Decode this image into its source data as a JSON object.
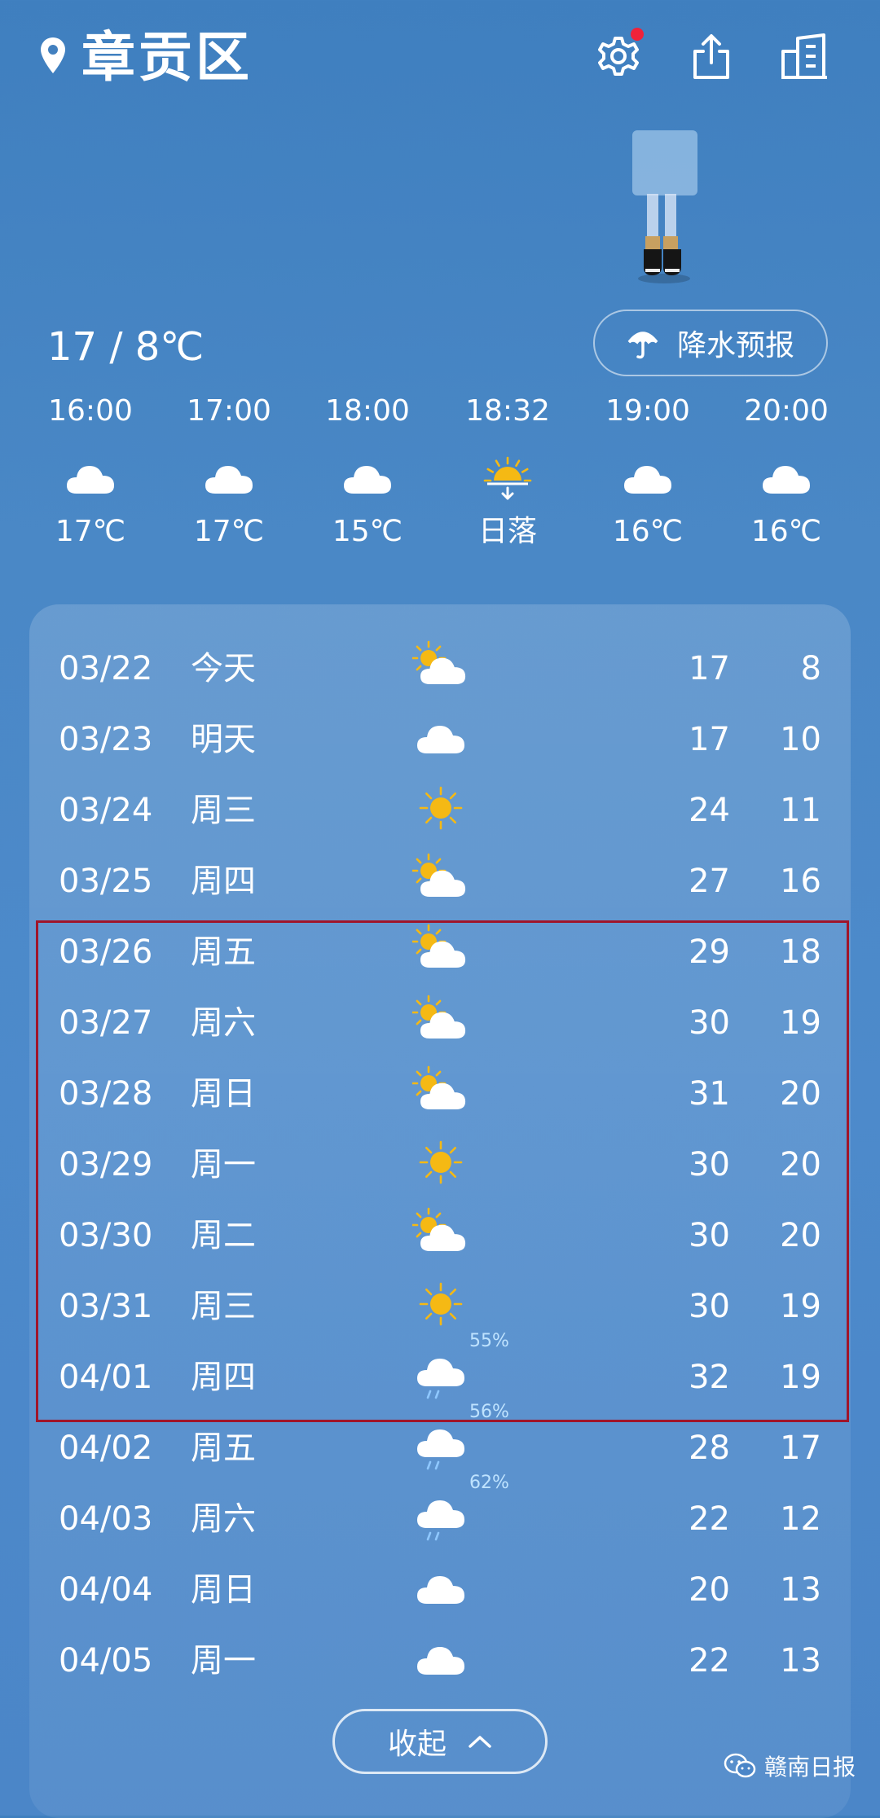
{
  "header": {
    "location": "章贡区",
    "has_notification_dot": true
  },
  "summary": {
    "temp_range": "17 / 8℃",
    "precip_button": "降水预报"
  },
  "hourly": [
    {
      "time": "16:00",
      "icon": "cloud-icon",
      "value": "17℃"
    },
    {
      "time": "17:00",
      "icon": "cloud-icon",
      "value": "17℃"
    },
    {
      "time": "18:00",
      "icon": "cloud-icon",
      "value": "15℃"
    },
    {
      "time": "18:32",
      "icon": "sunset-icon",
      "value": "日落"
    },
    {
      "time": "19:00",
      "icon": "cloud-icon",
      "value": "16℃"
    },
    {
      "time": "20:00",
      "icon": "cloud-icon",
      "value": "16℃"
    }
  ],
  "daily": [
    {
      "date": "03/22",
      "weekday": "今天",
      "icon": "partly-cloudy-icon",
      "precip": "",
      "high": "17",
      "low": "8"
    },
    {
      "date": "03/23",
      "weekday": "明天",
      "icon": "cloud-icon",
      "precip": "",
      "high": "17",
      "low": "10"
    },
    {
      "date": "03/24",
      "weekday": "周三",
      "icon": "sun-icon",
      "precip": "",
      "high": "24",
      "low": "11"
    },
    {
      "date": "03/25",
      "weekday": "周四",
      "icon": "partly-cloudy-icon",
      "precip": "",
      "high": "27",
      "low": "16"
    },
    {
      "date": "03/26",
      "weekday": "周五",
      "icon": "partly-cloudy-icon",
      "precip": "",
      "high": "29",
      "low": "18"
    },
    {
      "date": "03/27",
      "weekday": "周六",
      "icon": "partly-cloudy-icon",
      "precip": "",
      "high": "30",
      "low": "19"
    },
    {
      "date": "03/28",
      "weekday": "周日",
      "icon": "partly-cloudy-icon",
      "precip": "",
      "high": "31",
      "low": "20"
    },
    {
      "date": "03/29",
      "weekday": "周一",
      "icon": "sun-icon",
      "precip": "",
      "high": "30",
      "low": "20"
    },
    {
      "date": "03/30",
      "weekday": "周二",
      "icon": "partly-cloudy-icon",
      "precip": "",
      "high": "30",
      "low": "20"
    },
    {
      "date": "03/31",
      "weekday": "周三",
      "icon": "sun-icon",
      "precip": "",
      "high": "30",
      "low": "19"
    },
    {
      "date": "04/01",
      "weekday": "周四",
      "icon": "rain-icon",
      "precip": "55%",
      "high": "32",
      "low": "19"
    },
    {
      "date": "04/02",
      "weekday": "周五",
      "icon": "rain-icon",
      "precip": "56%",
      "high": "28",
      "low": "17"
    },
    {
      "date": "04/03",
      "weekday": "周六",
      "icon": "rain-icon",
      "precip": "62%",
      "high": "22",
      "low": "12"
    },
    {
      "date": "04/04",
      "weekday": "周日",
      "icon": "cloud-icon",
      "precip": "",
      "high": "20",
      "low": "13"
    },
    {
      "date": "04/05",
      "weekday": "周一",
      "icon": "cloud-icon",
      "precip": "",
      "high": "22",
      "low": "13"
    }
  ],
  "collapse_button": "收起",
  "watermark": "赣南日报",
  "colors": {
    "sun": "#f5b914",
    "highlight_border": "#a0152a",
    "notification_dot": "#f0223a"
  }
}
